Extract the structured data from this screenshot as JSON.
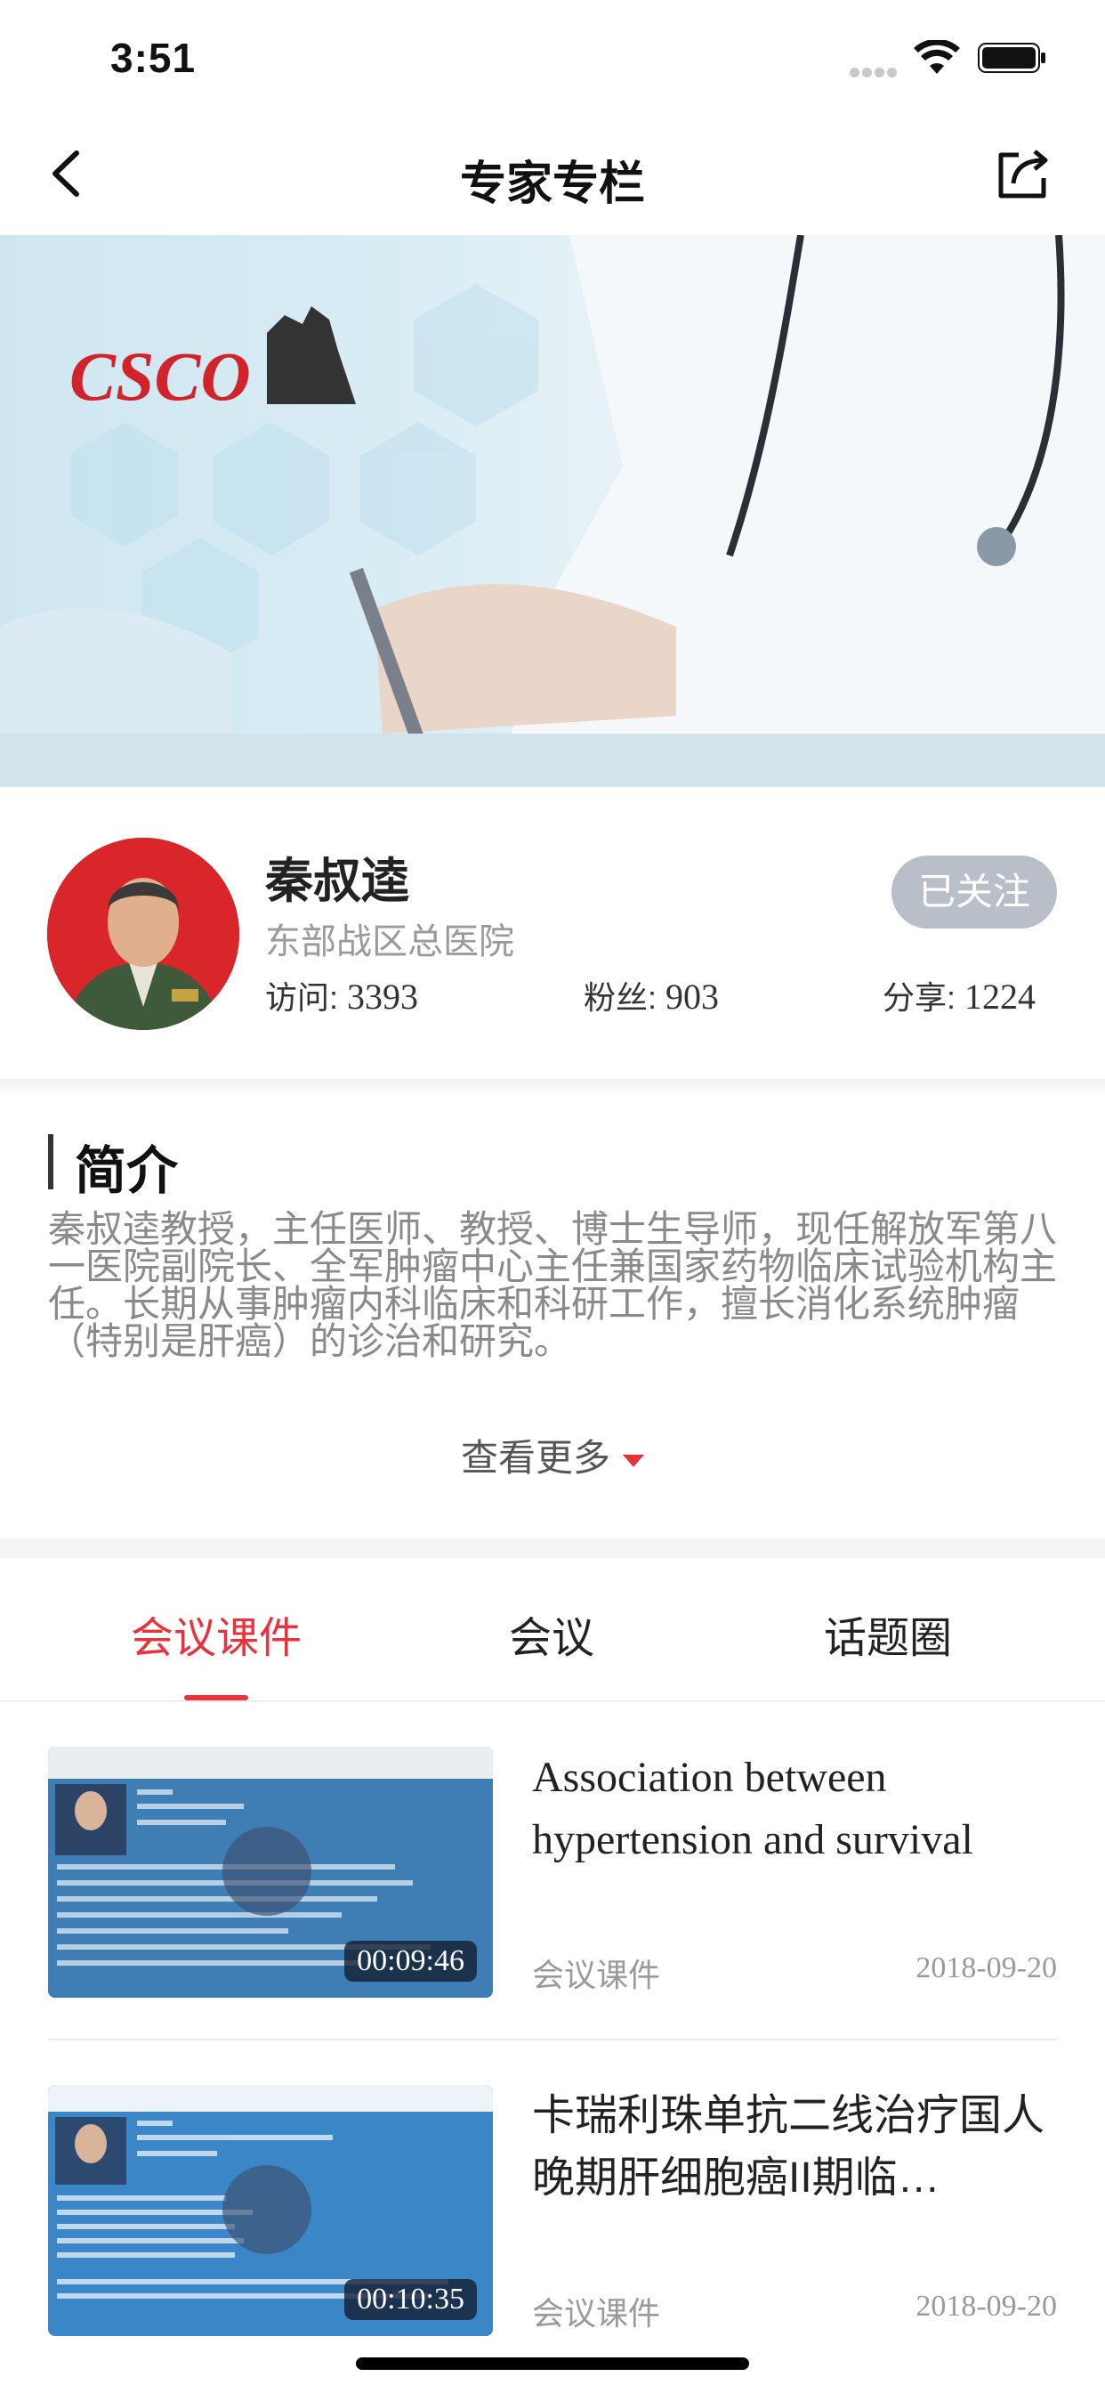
{
  "status_bar": {
    "time": "3:51"
  },
  "nav": {
    "title": "专家专栏"
  },
  "banner": {
    "logo_text": "CSCO"
  },
  "doctor": {
    "name": "秦叔逵",
    "hospital": "东部战区总医院",
    "follow_label": "已关注",
    "stats": [
      {
        "label": "访问:",
        "value": "3393"
      },
      {
        "label": "粉丝:",
        "value": "903"
      },
      {
        "label": "分享:",
        "value": "1224"
      }
    ]
  },
  "intro": {
    "title": "简介",
    "text": "秦叔逵教授，主任医师、教授、博士生导师，现任解放军第八一医院副院长、全军肿瘤中心主任兼国家药物临床试验机构主任。长期从事肿瘤内科临床和科研工作，擅长消化系统肿瘤（特别是肝癌）的诊治和研究。",
    "see_more": "查看更多"
  },
  "tabs": [
    {
      "label": "会议课件",
      "active": true
    },
    {
      "label": "会议",
      "active": false
    },
    {
      "label": "话题圈",
      "active": false
    }
  ],
  "list": [
    {
      "title": "Association between hypertension and survival benefit…",
      "type": "会议课件",
      "date": "2018-09-20",
      "duration": "00:09:46"
    },
    {
      "title": "卡瑞利珠单抗二线治疗国人晚期肝细胞癌II期临…",
      "type": "会议课件",
      "date": "2018-09-20",
      "duration": "00:10:35"
    }
  ],
  "colors": {
    "accent": "#e8333c",
    "follow_bg": "#b8bfc8",
    "thumb_bg": "#3d7fb8"
  }
}
